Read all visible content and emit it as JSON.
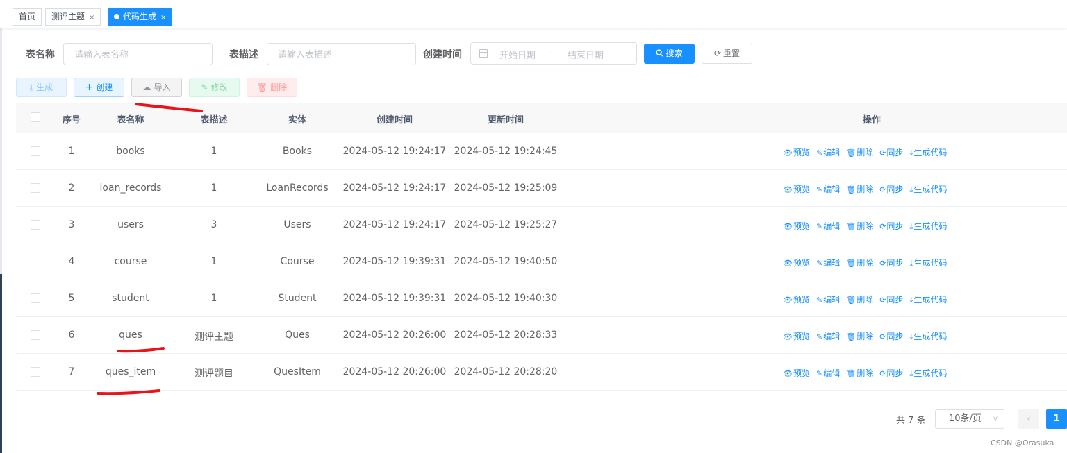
{
  "tags": {
    "home": "首页",
    "eval": "测评主题",
    "eval_close": "×",
    "active": "代码生成",
    "active_close": "×"
  },
  "search": {
    "table_name_label": "表名称",
    "table_name_placeholder": "请输入表名称",
    "table_desc_label": "表描述",
    "table_desc_placeholder": "请输入表描述",
    "create_time_label": "创建时间",
    "start_date": "开始日期",
    "range_sep": "-",
    "end_date": "结束日期",
    "search_button": "搜索",
    "reset_button": "重置"
  },
  "toolbar": {
    "generate": "生成",
    "create": "创建",
    "import": "导入",
    "edit": "修改",
    "delete": "删除"
  },
  "table": {
    "headers": {
      "index": "序号",
      "name": "表名称",
      "desc": "表描述",
      "entity": "实体",
      "created": "创建时间",
      "updated": "更新时间",
      "ops": "操作"
    },
    "rows": [
      {
        "index": "1",
        "name": "books",
        "desc": "1",
        "entity": "Books",
        "created": "2024-05-12 19:24:17",
        "updated": "2024-05-12 19:24:45"
      },
      {
        "index": "2",
        "name": "loan_records",
        "desc": "1",
        "entity": "LoanRecords",
        "created": "2024-05-12 19:24:17",
        "updated": "2024-05-12 19:25:09"
      },
      {
        "index": "3",
        "name": "users",
        "desc": "3",
        "entity": "Users",
        "created": "2024-05-12 19:24:17",
        "updated": "2024-05-12 19:25:27"
      },
      {
        "index": "4",
        "name": "course",
        "desc": "1",
        "entity": "Course",
        "created": "2024-05-12 19:39:31",
        "updated": "2024-05-12 19:40:50"
      },
      {
        "index": "5",
        "name": "student",
        "desc": "1",
        "entity": "Student",
        "created": "2024-05-12 19:39:31",
        "updated": "2024-05-12 19:40:30"
      },
      {
        "index": "6",
        "name": "ques",
        "desc": "测评主题",
        "entity": "Ques",
        "created": "2024-05-12 20:26:00",
        "updated": "2024-05-12 20:28:33"
      },
      {
        "index": "7",
        "name": "ques_item",
        "desc": "测评题目",
        "entity": "QuesItem",
        "created": "2024-05-12 20:26:00",
        "updated": "2024-05-12 20:28:20"
      }
    ],
    "row_actions": {
      "preview": "预览",
      "edit": "编辑",
      "delete": "删除",
      "sync": "同步",
      "generate": "生成代码"
    }
  },
  "pagination": {
    "total": "共 7 条",
    "page_size": "10条/页",
    "current_page": "1"
  },
  "watermark": "CSDN @Orasuka",
  "colors": {
    "primary": "#1890ff",
    "annotation": "#e8141a"
  }
}
